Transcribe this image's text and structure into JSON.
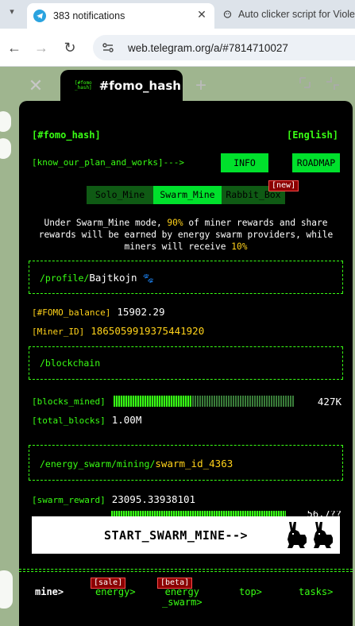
{
  "browser": {
    "tabs": [
      {
        "title": "383 notifications",
        "active": true
      },
      {
        "title": "Auto clicker script for Viole",
        "active": false
      }
    ],
    "url": "web.telegram.org/a/#7814710027"
  },
  "app": {
    "tab_name": "#fomo_hash",
    "logo_small_text": "[#fomo\n_hash]",
    "header_title": "[#fomo_hash]",
    "language": "[English]",
    "plan_link": "[know_our_plan_and_works]--->",
    "info_button": "INFO",
    "roadmap_button": "ROADMAP",
    "modes": [
      {
        "label": "Solo_Mine",
        "active": false
      },
      {
        "label": "Swarm_Mine",
        "active": true
      },
      {
        "label": "Rabbit_Box",
        "active": false,
        "tag": "[new]"
      }
    ],
    "mode_description": {
      "part1": "Under Swarm_Mine mode, ",
      "pct1": "90%",
      "part2": " of miner rewards and share rewards will be earned by energy swarm providers, while miners will receive ",
      "pct2": "10%"
    },
    "profile": {
      "label": "/profile/",
      "username": "Bajtkojn",
      "paw": "🐾"
    },
    "balance_label": "[#FOMO_balance]",
    "balance_value": "15902.29",
    "miner_id_label": "[Miner_ID]",
    "miner_id_value": "1865059919375441920",
    "blockchain_label": "/blockchain",
    "blocks_mined_label": "[blocks_mined]",
    "blocks_mined_value": "427K",
    "blocks_mined_fraction": 0.43,
    "total_blocks_label": "[total_blocks]",
    "total_blocks_value": "1.00M",
    "swarm_path": "/energy_swarm/mining/",
    "swarm_id": "swarm_id_4363",
    "swarm_reward_label": "[swarm_reward]",
    "swarm_reward_value": "23095.33938101",
    "partial_row_value": "56,7??",
    "start_button": "START_SWARM_MINE-->",
    "nav": {
      "mine": "mine>",
      "energy": "energy>",
      "energy_tag": "[sale]",
      "energy_swarm_line1": "energy",
      "energy_swarm_line2": "_swarm>",
      "energy_swarm_tag": "[beta]",
      "top": "top>",
      "tasks": "tasks>"
    }
  },
  "colors": {
    "accent_green": "#39ff14",
    "button_green": "#00e12c",
    "yellow": "#ffd21a",
    "tag_red": "#8b0000"
  }
}
